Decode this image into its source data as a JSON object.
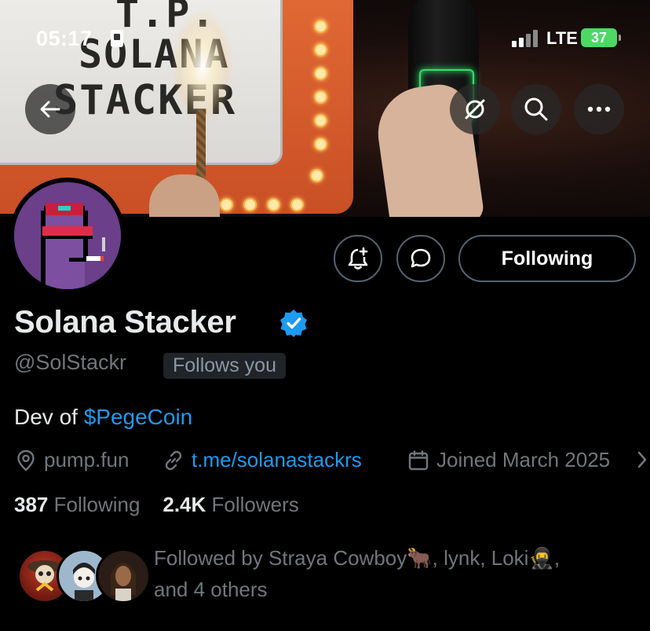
{
  "status_bar": {
    "time": "05:17",
    "network": "LTE",
    "battery": "37"
  },
  "banner": {
    "sign_lines": [
      "T.P.",
      "SOLANA",
      "STACKER"
    ]
  },
  "header_buttons": {
    "back": "back-arrow-icon",
    "grok": "grok-icon",
    "search": "search-icon",
    "more": "more-dots-icon"
  },
  "actions": {
    "following_label": "Following"
  },
  "profile": {
    "display_name": "Solana Stacker",
    "handle": "@SolStackr",
    "follows_you": "Follows you",
    "bio_prefix": "Dev of ",
    "bio_link": "$PegeCoin",
    "location": "pump.fun",
    "website": "t.me/solanastackrs",
    "joined": "Joined March 2025"
  },
  "stats": {
    "following_count": "387",
    "following_label": "Following",
    "followers_count": "2.4K",
    "followers_label": "Followers"
  },
  "followed_by": {
    "line1": "Followed by Straya Cowboy🐂, lynk, Loki🥷,",
    "line2": "and 4 others"
  },
  "colors": {
    "background": "#000000",
    "link_blue": "#1d9bf0",
    "secondary_text": "#71767b",
    "battery_green": "#4cd964"
  }
}
